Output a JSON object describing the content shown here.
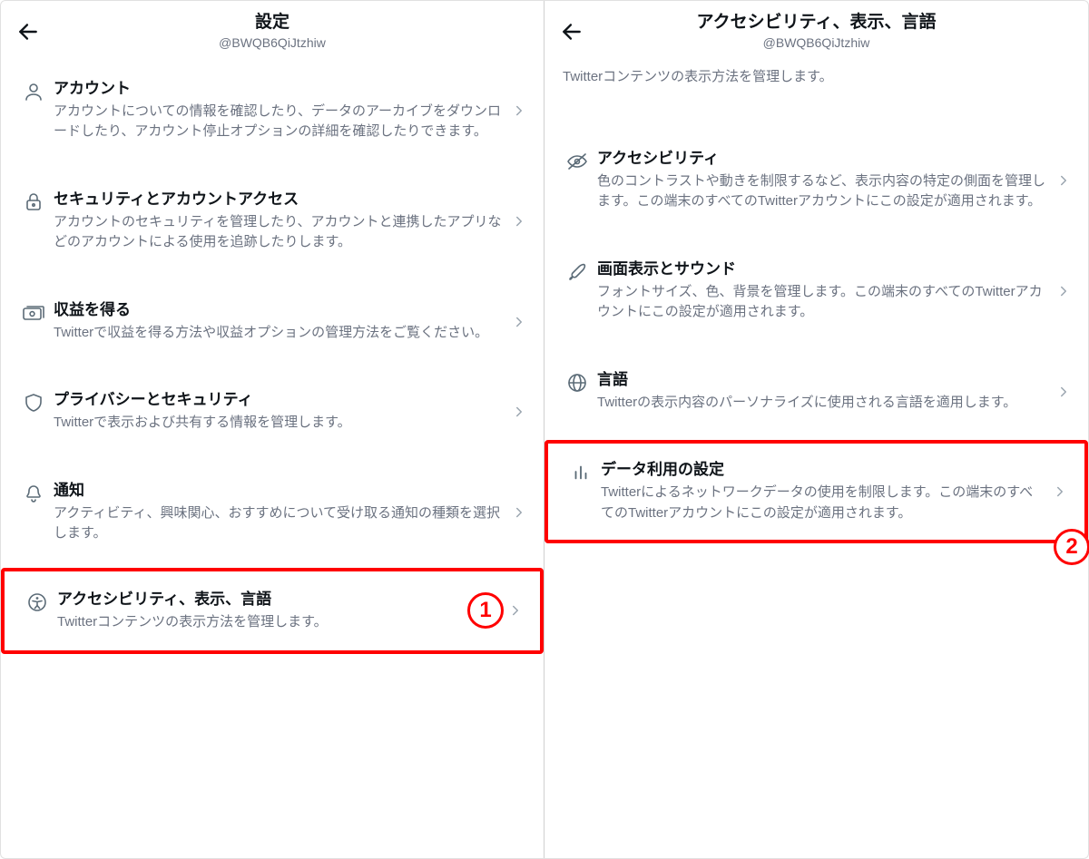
{
  "handle": "@BWQB6QiJtzhiw",
  "left": {
    "title": "設定",
    "items": [
      {
        "title": "アカウント",
        "desc": "アカウントについての情報を確認したり、データのアーカイブをダウンロードしたり、アカウント停止オプションの詳細を確認したりできます。"
      },
      {
        "title": "セキュリティとアカウントアクセス",
        "desc": "アカウントのセキュリティを管理したり、アカウントと連携したアプリなどのアカウントによる使用を追跡したりします。"
      },
      {
        "title": "収益を得る",
        "desc": "Twitterで収益を得る方法や収益オプションの管理方法をご覧ください。"
      },
      {
        "title": "プライバシーとセキュリティ",
        "desc": "Twitterで表示および共有する情報を管理します。"
      },
      {
        "title": "通知",
        "desc": "アクティビティ、興味関心、おすすめについて受け取る通知の種類を選択します。"
      },
      {
        "title": "アクセシビリティ、表示、言語",
        "desc": "Twitterコンテンツの表示方法を管理します。"
      }
    ]
  },
  "right": {
    "title": "アクセシビリティ、表示、言語",
    "intro": "Twitterコンテンツの表示方法を管理します。",
    "items": [
      {
        "title": "アクセシビリティ",
        "desc": "色のコントラストや動きを制限するなど、表示内容の特定の側面を管理します。この端末のすべてのTwitterアカウントにこの設定が適用されます。"
      },
      {
        "title": "画面表示とサウンド",
        "desc": "フォントサイズ、色、背景を管理します。この端末のすべてのTwitterアカウントにこの設定が適用されます。"
      },
      {
        "title": "言語",
        "desc": "Twitterの表示内容のパーソナライズに使用される言語を適用します。"
      },
      {
        "title": "データ利用の設定",
        "desc": "Twitterによるネットワークデータの使用を制限します。この端末のすべてのTwitterアカウントにこの設定が適用されます。"
      }
    ]
  },
  "annotations": {
    "one": "1",
    "two": "2"
  }
}
